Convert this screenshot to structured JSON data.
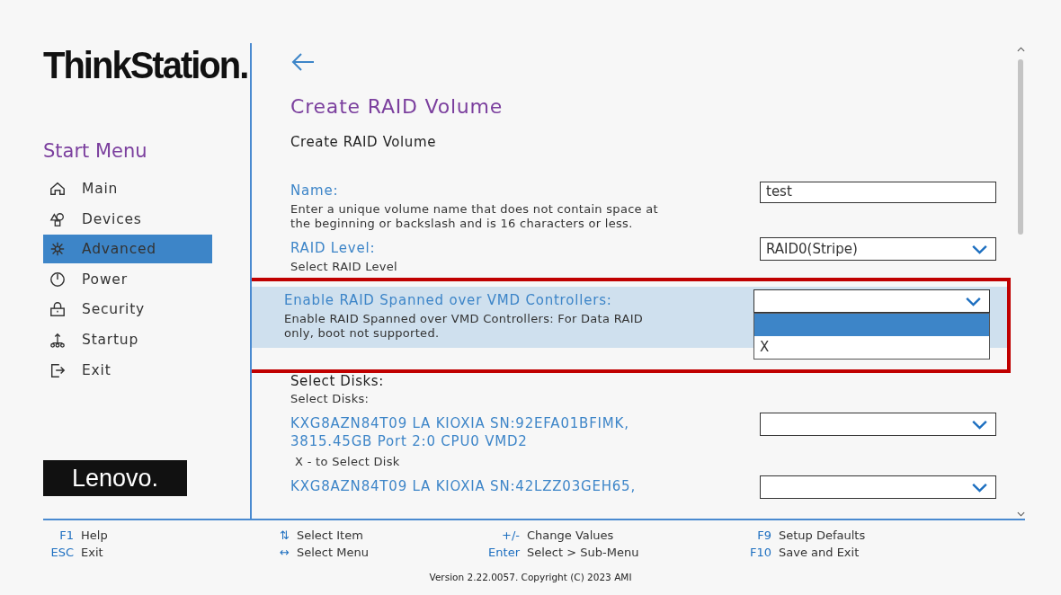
{
  "brand": {
    "logo": "ThinkStation.",
    "vendor_logo": "Lenovo."
  },
  "menu": {
    "title": "Start Menu",
    "items": [
      {
        "label": "Main",
        "selected": false
      },
      {
        "label": "Devices",
        "selected": false
      },
      {
        "label": "Advanced",
        "selected": true
      },
      {
        "label": "Power",
        "selected": false
      },
      {
        "label": "Security",
        "selected": false
      },
      {
        "label": "Startup",
        "selected": false
      },
      {
        "label": "Exit",
        "selected": false
      }
    ]
  },
  "page": {
    "title": "Create RAID Volume",
    "subtitle": "Create RAID Volume"
  },
  "settings": [
    {
      "kind": "text",
      "label": "Name:",
      "help": "Enter a unique volume name that does not contain space at the beginning or backslash and is 16 characters or less.",
      "value": "test",
      "selected": false,
      "annotated": false
    },
    {
      "kind": "dropdown",
      "label": "RAID Level:",
      "help": "Select RAID Level",
      "value": "RAID0(Stripe)",
      "selected": false,
      "annotated": false,
      "expanded": false
    },
    {
      "kind": "dropdown",
      "label": "Enable RAID Spanned over VMD Controllers:",
      "help": "Enable RAID Spanned over VMD Controllers: For Data RAID only, boot not supported.",
      "selected": true,
      "annotated": true,
      "expanded": true,
      "options": [
        {
          "selected": true
        },
        {
          "label": "X",
          "selected": false
        }
      ]
    },
    {
      "kind": "heading",
      "label": "Select Disks:",
      "help": "Select Disks:"
    },
    {
      "kind": "dropdown",
      "label": "KXG8AZN84T09 LA KIOXIA SN:92EFA01BFIMK, 3815.45GB  Port 2:0 CPU0 VMD2",
      "help": "X - to Select Disk",
      "selected": false,
      "annotated": false,
      "expanded": false
    },
    {
      "kind": "dropdown",
      "label": "KXG8AZN84T09 LA KIOXIA SN:42LZZ03GEH65,",
      "selected": false,
      "annotated": false,
      "expanded": false
    }
  ],
  "footer": {
    "hints": [
      [
        {
          "key": "F1",
          "action": "Help"
        },
        {
          "key": "ESC",
          "action": "Exit"
        }
      ],
      [
        {
          "key": "⇅",
          "action": "Select Item"
        },
        {
          "key": "↔",
          "action": "Select Menu"
        }
      ],
      [
        {
          "key": "+/-",
          "action": "Change Values"
        },
        {
          "key": "Enter",
          "action": "Select > Sub-Menu"
        }
      ],
      [
        {
          "key": "F9",
          "action": "Setup Defaults"
        },
        {
          "key": "F10",
          "action": "Save and Exit"
        }
      ]
    ],
    "version": "Version 2.22.0057. Copyright (C) 2023 AMI"
  }
}
